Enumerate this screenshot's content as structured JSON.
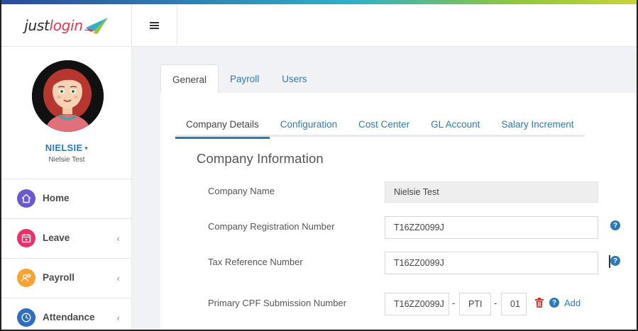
{
  "brand": {
    "just": "just",
    "login": "login"
  },
  "header": {
    "menu_icon": "hamburger-icon"
  },
  "profile": {
    "name": "NIELSIE",
    "caret": "▾",
    "full_name": "Nielsie Test"
  },
  "sidebar": {
    "items": [
      {
        "label": "Home",
        "icon": "home-icon",
        "color": "#6a5acd",
        "has_chevron": false
      },
      {
        "label": "Leave",
        "icon": "calendar-icon",
        "color": "#e8336a",
        "has_chevron": true
      },
      {
        "label": "Payroll",
        "icon": "payroll-icon",
        "color": "#f7a233",
        "has_chevron": true
      },
      {
        "label": "Attendance",
        "icon": "clock-icon",
        "color": "#2f6ebf",
        "has_chevron": true
      }
    ],
    "chevron": "‹"
  },
  "tabs": [
    "General",
    "Payroll",
    "Users"
  ],
  "subtabs": [
    "Company Details",
    "Configuration",
    "Cost Center",
    "GL Account",
    "Salary Increment"
  ],
  "section_title": "Company Information",
  "form": {
    "company_name": {
      "label": "Company Name",
      "value": "Nielsie Test"
    },
    "registration": {
      "label": "Company Registration Number",
      "value": "T16ZZ0099J"
    },
    "tax_ref": {
      "label": "Tax Reference Number",
      "value": "T16ZZ0099J"
    },
    "cpf": {
      "label": "Primary CPF Submission Number",
      "part1": "T16ZZ0099J",
      "part2": "PTI",
      "part3": "01",
      "dash": "-",
      "add": "Add"
    }
  },
  "colors": {
    "accent": "#2a7ab8",
    "danger": "#c9302c"
  }
}
